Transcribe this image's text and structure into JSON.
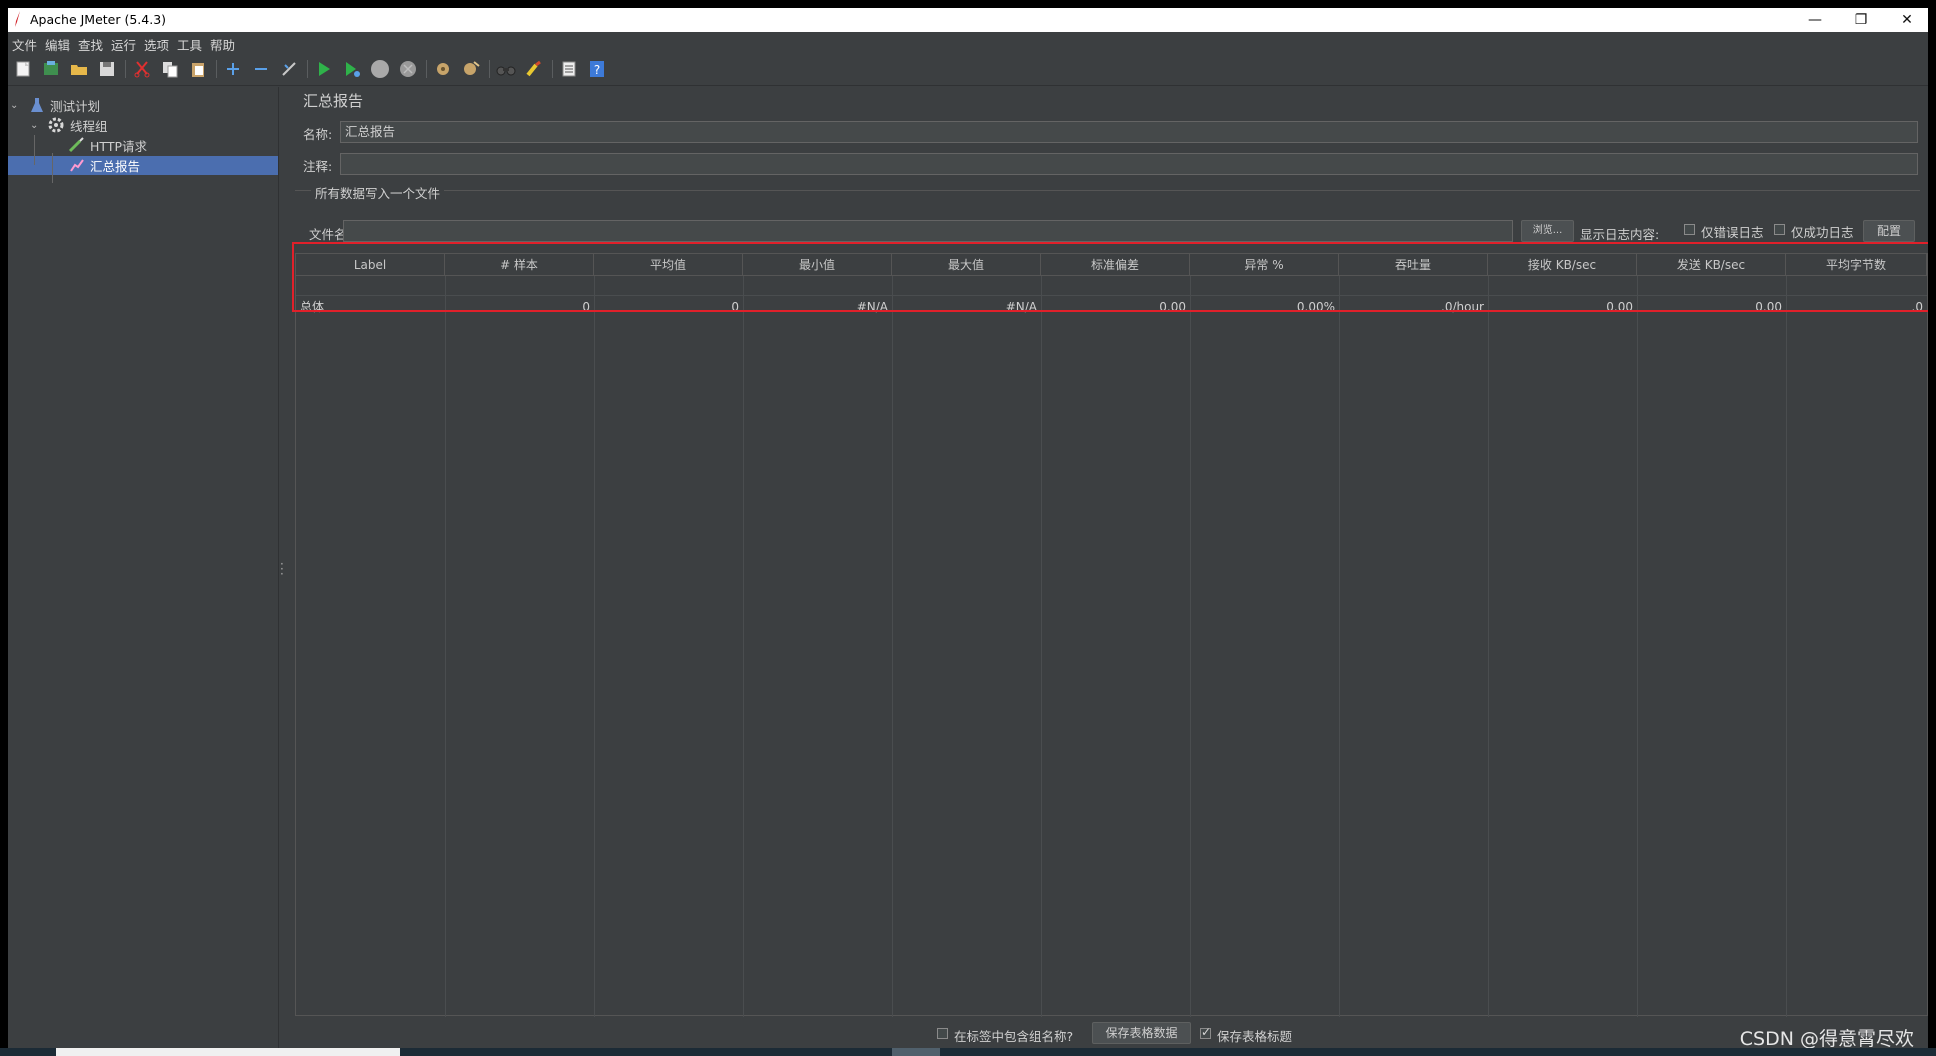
{
  "window": {
    "title": "Apache JMeter (5.4.3)"
  },
  "window_controls": {
    "minimize": "—",
    "restore": "❐",
    "close": "✕"
  },
  "menu": [
    "文件",
    "编辑",
    "查找",
    "运行",
    "选项",
    "工具",
    "帮助"
  ],
  "toolbar": [
    "new-icon",
    "templates-icon",
    "open-icon",
    "save-icon",
    "cut-icon",
    "copy-icon",
    "paste-icon",
    "expand-icon",
    "collapse-icon",
    "toggle-icon",
    "start-icon",
    "start-no-pause-icon",
    "stop-icon",
    "shutdown-icon",
    "clear-icon",
    "clear-all-icon",
    "search-icon",
    "reset-search-icon",
    "function-helper-icon",
    "help-icon"
  ],
  "tree": {
    "items": [
      {
        "label": "测试计划",
        "level": 0
      },
      {
        "label": "线程组",
        "level": 1
      },
      {
        "label": "HTTP请求",
        "level": 2
      },
      {
        "label": "汇总报告",
        "level": 2,
        "selected": true
      }
    ]
  },
  "panel": {
    "title": "汇总报告",
    "name_label": "名称:",
    "name_value": "汇总报告",
    "comment_label": "注释:",
    "comment_value": "",
    "file_section": "所有数据写入一个文件",
    "file_label": "文件名",
    "file_value": "",
    "browse_button": "浏览...",
    "log_label": "显示日志内容:",
    "errors_only": "仅错误日志",
    "success_only": "仅成功日志",
    "configure_button": "配置"
  },
  "table": {
    "headers": [
      "Label",
      "# 样本",
      "平均值",
      "最小值",
      "最大值",
      "标准偏差",
      "异常 %",
      "吞吐量",
      "接收 KB/sec",
      "发送 KB/sec",
      "平均字节数"
    ],
    "rows": [
      [
        "总体",
        "0",
        "0",
        "#N/A",
        "#N/A",
        "0.00",
        "0.00%",
        ".0/hour",
        "0.00",
        "0.00",
        ".0"
      ]
    ]
  },
  "bottom": {
    "include_group_label": "在标签中包含组名称?",
    "save_table_button": "保存表格数据",
    "save_header_label": "保存表格标题",
    "save_header_checked": true,
    "include_group_checked": false
  },
  "watermark": "CSDN @得意霄尽欢",
  "colors": {
    "accent": "#4b6eaf",
    "highlight": "#e1202a",
    "background": "#3c3f41"
  }
}
